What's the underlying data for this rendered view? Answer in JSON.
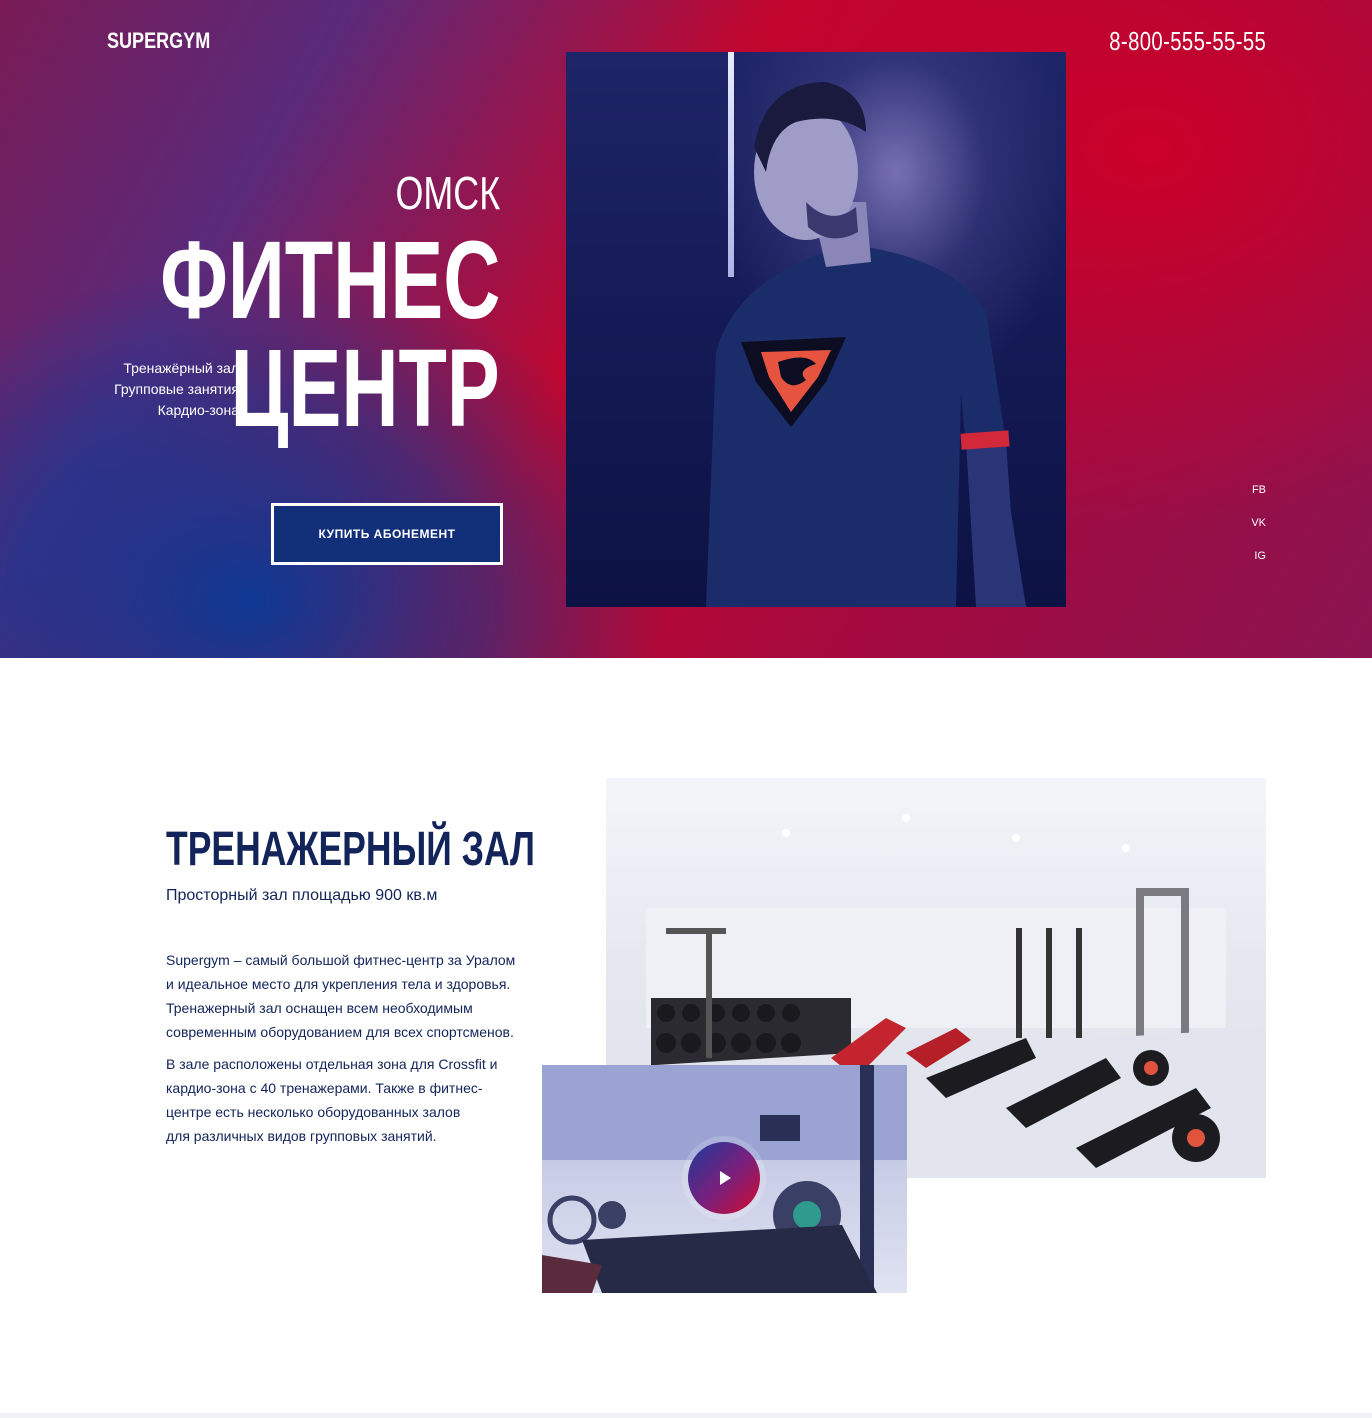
{
  "header": {
    "logo": "SUPERGYM",
    "phone": "8-800-555-55-55"
  },
  "hero": {
    "city": "ОМСК",
    "title_line_1": "ФИТНЕС",
    "title_line_2": "ЦЕНТР",
    "services": [
      "Тренажёрный зал",
      "Групповые занятия",
      "Кардио-зона"
    ],
    "cta_label": "КУПИТЬ АБОНЕМЕНТ"
  },
  "social": [
    "FB",
    "VK",
    "IG"
  ],
  "gym_section": {
    "title": "ТРЕНАЖЕРНЫЙ ЗАЛ",
    "subtitle": "Просторный зал площадью 900 кв.м",
    "paragraph_1_lines": [
      "Supergym – самый большой фитнес-центр за Уралом",
      "и идеальное место для укрепления тела и здоровья.",
      "Тренажерный зал оснащен всем необходимым",
      "современным оборудованием для всех спортсменов."
    ],
    "paragraph_2_lines": [
      "В зале расположены отдельная зона для Crossfit и",
      "кардио-зона с 40 тренажерами. Также в фитнес-",
      "центре есть несколько оборудованных залов",
      "для различных видов групповых занятий."
    ]
  },
  "colors": {
    "brand_red": "#c0062e",
    "brand_blue": "#12307a",
    "text_navy": "#12245a"
  }
}
